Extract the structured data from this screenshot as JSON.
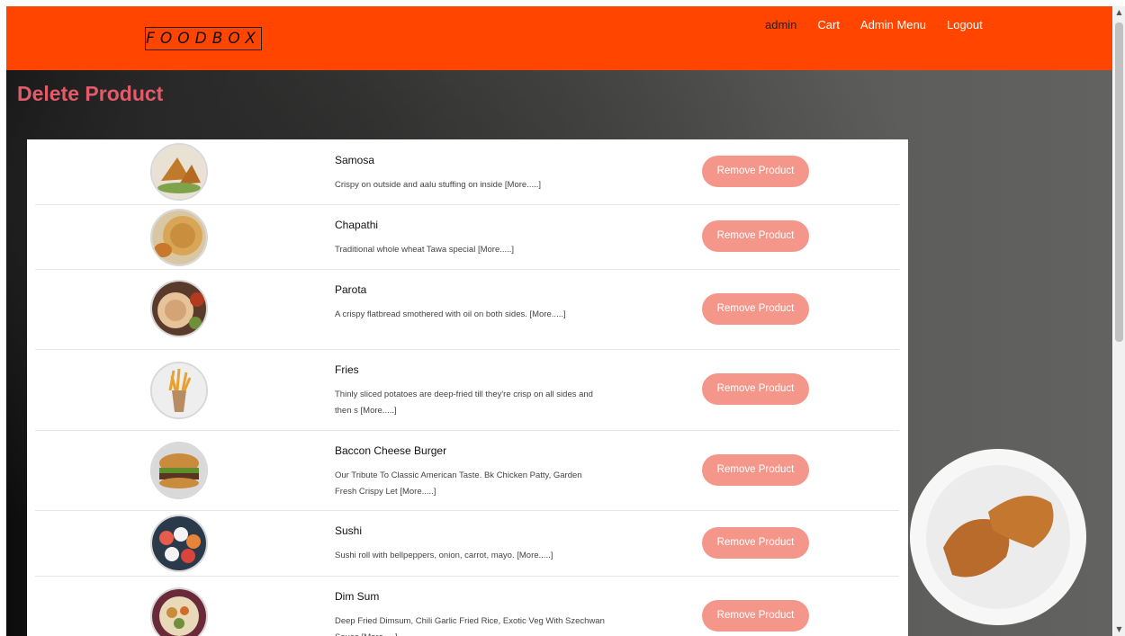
{
  "brand": "FOODBOX",
  "nav": {
    "user": "admin",
    "cart": "Cart",
    "admin_menu": "Admin Menu",
    "logout": "Logout"
  },
  "page_title": "Delete Product",
  "remove_label": "Remove Product",
  "products": [
    {
      "name": "Samosa",
      "desc": "Crispy on outside and aalu stuffing on inside [More.....]",
      "icon": "samosa-image"
    },
    {
      "name": "Chapathi",
      "desc": "Traditional whole wheat Tawa special [More.....]",
      "icon": "chapathi-image"
    },
    {
      "name": "Parota",
      "desc": "A crispy flatbread smothered with oil on both sides. [More.....]",
      "icon": "parota-image"
    },
    {
      "name": "Fries",
      "desc": "Thinly sliced potatoes are deep-fried till they're crisp on all sides and then s [More.....]",
      "icon": "fries-image"
    },
    {
      "name": "Baccon Cheese Burger",
      "desc": "Our Tribute To Classic American Taste. Bk Chicken Patty, Garden Fresh Crispy Let [More.....]",
      "icon": "burger-image"
    },
    {
      "name": "Sushi",
      "desc": "Sushi roll with bellpeppers, onion, carrot, mayo. [More.....]",
      "icon": "sushi-image"
    },
    {
      "name": "Dim Sum",
      "desc": "Deep Fried Dimsum, Chili Garlic Fried Rice, Exotic Veg With Szechwan Sauce [More.....]",
      "icon": "dimsum-image"
    }
  ],
  "colors": {
    "navbar": "#ff4500",
    "title": "#e25b6b",
    "button": "#f4978a"
  }
}
